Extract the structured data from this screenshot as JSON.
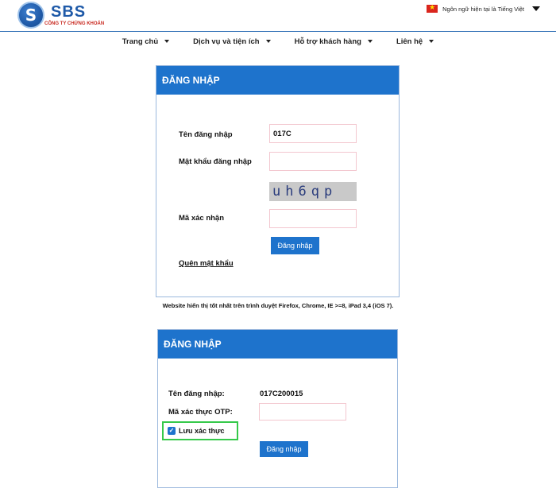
{
  "header": {
    "logo_letter": "S",
    "logo_name": "SBS",
    "logo_subtitle": "CÔNG TY CHỨNG KHOÁN",
    "language_text": "Ngôn ngữ hiện tại là Tiếng Việt"
  },
  "nav": {
    "items": [
      {
        "label": "Trang chủ"
      },
      {
        "label": "Dịch vụ và tiện ích"
      },
      {
        "label": "Hỗ trợ khách hàng"
      },
      {
        "label": "Liên hệ"
      }
    ]
  },
  "login1": {
    "title": "ĐĂNG NHẬP",
    "username_label": "Tên đăng nhập",
    "username_value": "017C",
    "password_label": "Mật khẩu đăng nhập",
    "captcha_text": "uh6qp",
    "captcha_label": "Mã xác nhận",
    "submit_label": "Đăng nhập",
    "forgot_label": "Quên mật khẩu"
  },
  "browser_note": "Website hiển thị tốt nhất trên trình duyệt Firefox, Chrome, IE >=8, iPad 3,4 (iOS 7).",
  "login2": {
    "title": "ĐĂNG NHẬP",
    "username_label": "Tên đăng nhập:",
    "username_value": "017C200015",
    "otp_label": "Mã xác thực OTP:",
    "remember_label": "Lưu xác thực",
    "submit_label": "Đăng nhập"
  },
  "colors": {
    "accent": "#1e73cc",
    "highlight": "#35c94a"
  }
}
